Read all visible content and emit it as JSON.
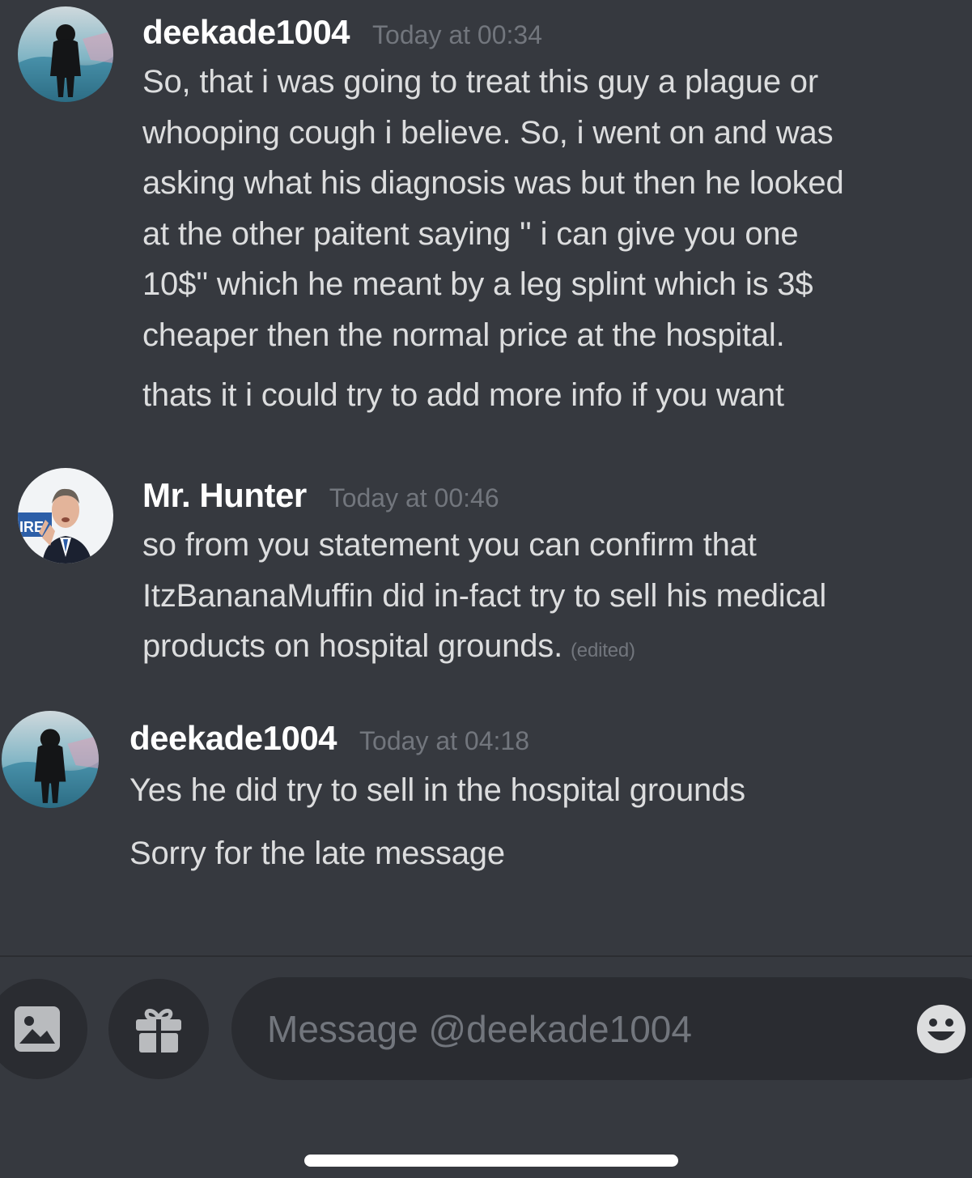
{
  "messages": [
    {
      "username": "deekade1004",
      "timestamp": "Today at 00:34",
      "avatar_icon": "hooded-figure-avatar",
      "lines": [
        "So, that i was going to treat this guy a plague or",
        "whooping cough i believe. So, i went on and was",
        "asking what his diagnosis was but then he looked",
        "at the other paitent saying '' i can give you one",
        "10$'' which he meant by a leg splint which is 3$",
        "cheaper then the normal price at the hospital."
      ],
      "followup": "thats it i could try to add more info if you want"
    },
    {
      "username": "Mr. Hunter",
      "timestamp": "Today at 00:46",
      "avatar_icon": "man-in-suit-avatar",
      "lines": [
        "so from you statement you can confirm that",
        "ItzBananaMuffin did in-fact try to sell his medical",
        "products on hospital grounds."
      ],
      "edited_label": "(edited)"
    },
    {
      "username": "deekade1004",
      "timestamp": "Today at 04:18",
      "avatar_icon": "hooded-figure-avatar",
      "lines": [
        "Yes he did try to sell in the hospital grounds"
      ],
      "followup": "Sorry for the late message"
    }
  ],
  "composer": {
    "placeholder": "Message @deekade1004",
    "icons": [
      "image-upload-icon",
      "gift-icon",
      "emoji-icon"
    ]
  },
  "colors": {
    "background": "#36393f",
    "input_background": "#2a2c31",
    "username": "#ffffff",
    "text": "#dcddde",
    "muted": "#72767d"
  }
}
